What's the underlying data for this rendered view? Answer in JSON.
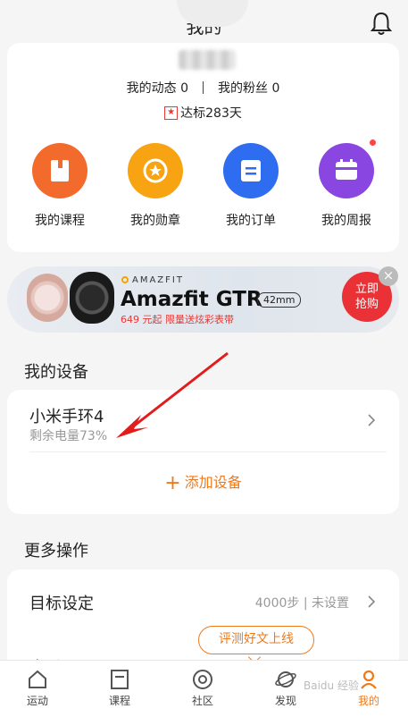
{
  "header": {
    "title": "我的",
    "bell_icon": "bell-icon"
  },
  "profile": {
    "posts_label": "我的动态 0",
    "fans_label": "我的粉丝 0",
    "streak_icon": "star-badge-icon",
    "streak_label": "达标283天"
  },
  "shortcuts": [
    {
      "label": "我的课程",
      "icon": "book-icon",
      "color": "#f26a2c"
    },
    {
      "label": "我的勋章",
      "icon": "medal-icon",
      "color": "#f7a312"
    },
    {
      "label": "我的订单",
      "icon": "order-icon",
      "color": "#2f6df0"
    },
    {
      "label": "我的周报",
      "icon": "calendar-icon",
      "color": "#8a46e0"
    }
  ],
  "banner": {
    "brand": "AMAZFIT",
    "model": "Amazfit GTR",
    "size": "42mm",
    "promo": "649 元起  限量送炫彩表带",
    "cta_line1": "立即",
    "cta_line2": "抢购",
    "close": "×"
  },
  "devices": {
    "title": "我的设备",
    "device_name": "小米手环4",
    "battery": "剩余电量73%",
    "add_label": "添加设备",
    "add_icon": "+"
  },
  "more": {
    "title": "更多操作",
    "goal_label": "目标设定",
    "goal_value": "4000步 | 未设置",
    "next_label": "音乐"
  },
  "bubble": {
    "label": "评测好文上线"
  },
  "tabbar": [
    {
      "label": "运动",
      "icon": "house-icon"
    },
    {
      "label": "课程",
      "icon": "course-icon"
    },
    {
      "label": "社区",
      "icon": "community-icon"
    },
    {
      "label": "发现",
      "icon": "planet-icon"
    },
    {
      "label": "我的",
      "icon": "person-icon",
      "active": true
    }
  ],
  "watermark": "Baidu 经验",
  "colors": {
    "accent": "#f07a1a",
    "banner_cta": "#ea3136",
    "arrow": "#e21b1b"
  }
}
